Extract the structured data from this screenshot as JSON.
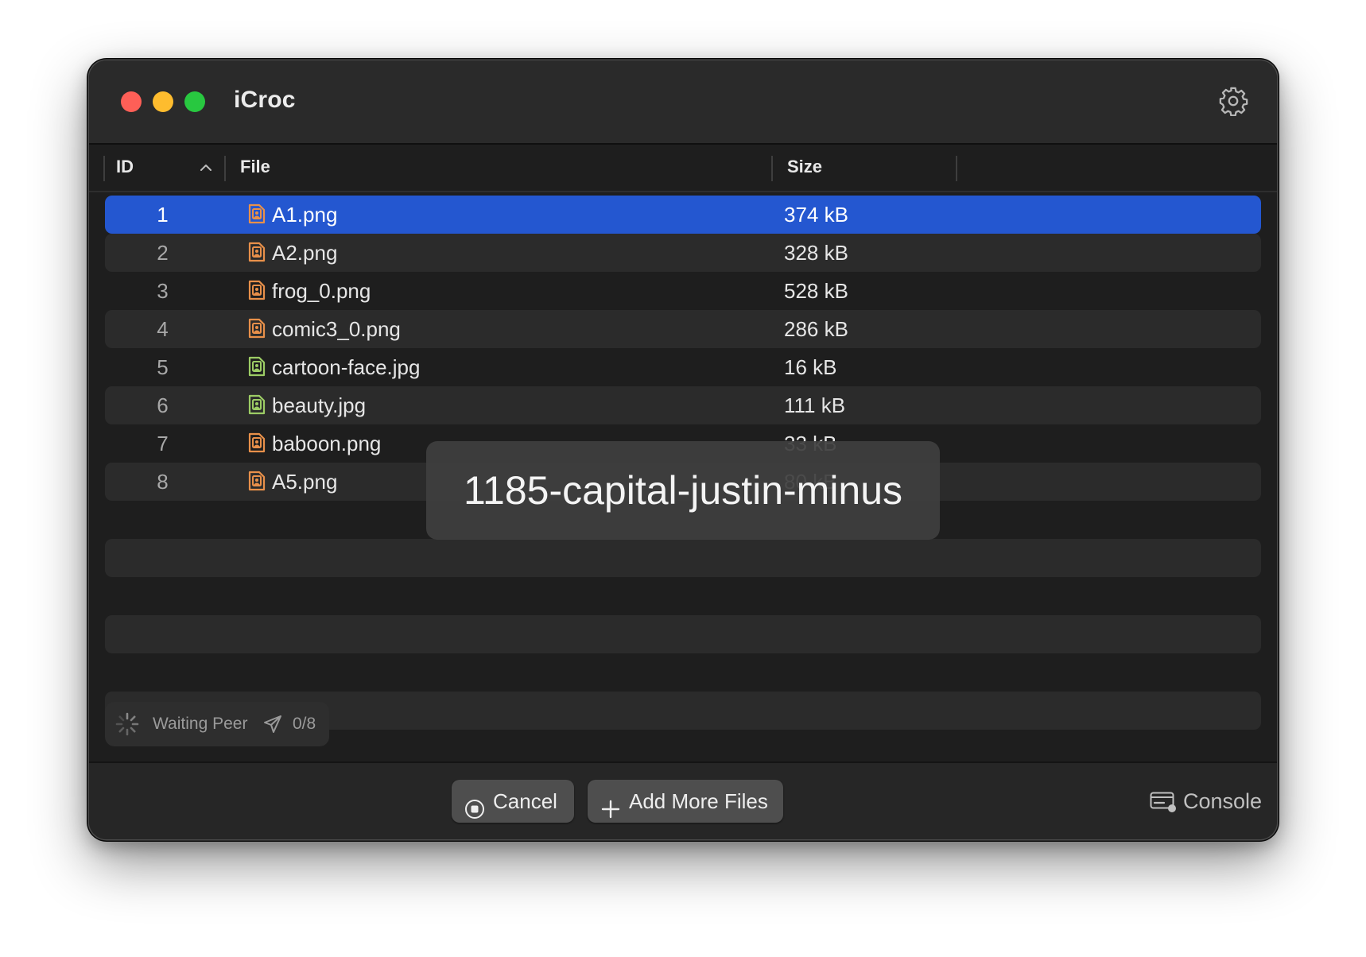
{
  "window": {
    "title": "iCroc"
  },
  "table": {
    "columns": {
      "id": "ID",
      "file": "File",
      "size": "Size"
    },
    "sort": {
      "column": "ID",
      "direction": "ascending"
    },
    "rows": [
      {
        "id": "1",
        "name": "A1.png",
        "size": "374 kB",
        "kind": "png",
        "selected": true
      },
      {
        "id": "2",
        "name": "A2.png",
        "size": "328 kB",
        "kind": "png"
      },
      {
        "id": "3",
        "name": "frog_0.png",
        "size": "528 kB",
        "kind": "png"
      },
      {
        "id": "4",
        "name": "comic3_0.png",
        "size": "286 kB",
        "kind": "png"
      },
      {
        "id": "5",
        "name": "cartoon-face.jpg",
        "size": "16 kB",
        "kind": "jpg"
      },
      {
        "id": "6",
        "name": "beauty.jpg",
        "size": "111 kB",
        "kind": "jpg"
      },
      {
        "id": "7",
        "name": "baboon.png",
        "size": "33 kB",
        "kind": "png"
      },
      {
        "id": "8",
        "name": "A5.png",
        "size": "80 kB",
        "kind": "png"
      }
    ]
  },
  "overlay": {
    "code": "1185-capital-justin-minus"
  },
  "status": {
    "text": "Waiting Peer",
    "count": "0/8"
  },
  "footer": {
    "cancel_label": "Cancel",
    "add_label": "Add More Files",
    "console_label": "Console"
  },
  "icons": {
    "gear": "gear-icon",
    "sort": "chevron-up-icon",
    "png": "image-file-icon",
    "jpg": "image-file-icon",
    "spinner": "spinner-icon",
    "send": "paper-plane-icon",
    "cancel": "stop-circle-icon",
    "add": "plus-icon",
    "console": "console-icon"
  },
  "colors": {
    "selection": "#2457d0",
    "png_icon": "#e8904a",
    "jpg_icon": "#9ccc65",
    "close": "#fe5f57",
    "minimize": "#febc2e",
    "zoom": "#28c840"
  }
}
